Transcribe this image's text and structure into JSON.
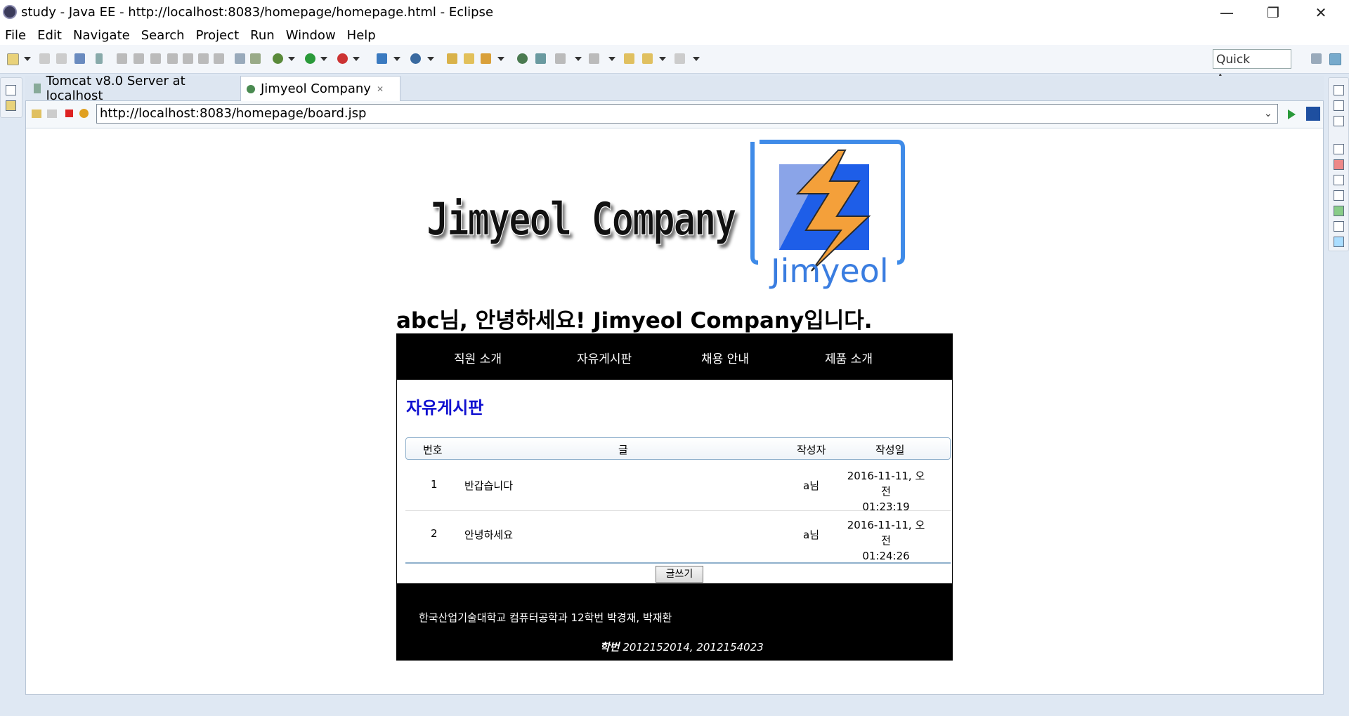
{
  "window": {
    "title": "study - Java EE - http://localhost:8083/homepage/homepage.html - Eclipse",
    "minimize": "—",
    "restore": "❐",
    "close": "✕"
  },
  "menu": [
    "File",
    "Edit",
    "Navigate",
    "Search",
    "Project",
    "Run",
    "Window",
    "Help"
  ],
  "toolbar": {
    "quick_access": "Quick Access"
  },
  "tabs": [
    {
      "label": "Tomcat v8.0 Server at localhost"
    },
    {
      "label": "Jimyeol Company",
      "close": "✕"
    }
  ],
  "browser": {
    "url": "http://localhost:8083/homepage/board.jsp"
  },
  "site": {
    "logo_text": "Jimyeol Company",
    "logo_caption": "Jimyeol",
    "greeting": "abc님, 안녕하세요! Jimyeol Company입니다.",
    "nav": [
      "직원 소개",
      "자유게시판",
      "채용 안내",
      "제품 소개"
    ],
    "board": {
      "title": "자유게시판",
      "headers": [
        "번호",
        "글",
        "작성자",
        "작성일"
      ],
      "rows": [
        {
          "no": "1",
          "title": "반갑습니다",
          "author": "a님",
          "date1": "2016-11-11, 오전",
          "date2": "01:23:19"
        },
        {
          "no": "2",
          "title": "안녕하세요",
          "author": "a님",
          "date1": "2016-11-11, 오전",
          "date2": "01:24:26"
        }
      ],
      "write_button": "글쓰기"
    },
    "footer": {
      "line1": "한국산업기술대학교 컴퓨터공학과 12학번 박경재, 박재환",
      "line2_label": "학번",
      "line2_value": " 2012152014, 2012154023"
    }
  }
}
